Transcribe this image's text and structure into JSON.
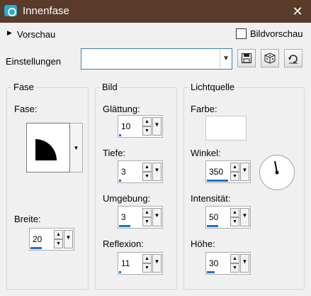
{
  "window": {
    "title": "Innenfase",
    "close_glyph": "✕",
    "icon": "camera-icon"
  },
  "preview": {
    "toggle_label": "Vorschau",
    "checkbox_label": "Bildvorschau",
    "checked": false
  },
  "settings": {
    "label": "Einstellungen",
    "combo_value": "",
    "buttons": [
      "save-icon",
      "dice-icon",
      "reset-icon"
    ]
  },
  "fase": {
    "group_title": "Fase",
    "fase_label": "Fase:",
    "breite_label": "Breite:",
    "breite_value": "20",
    "breite_level": 0.5
  },
  "bild": {
    "group_title": "Bild",
    "glaettung_label": "Glättung:",
    "glaettung_value": "10",
    "glaettung_level": 0.1,
    "tiefe_label": "Tiefe:",
    "tiefe_value": "3",
    "tiefe_level": 0.1,
    "umgebung_label": "Umgebung:",
    "umgebung_value": "3",
    "umgebung_level": 0.5,
    "reflexion_label": "Reflexion:",
    "reflexion_value": "11",
    "reflexion_level": 0.1
  },
  "licht": {
    "group_title": "Lichtquelle",
    "farbe_label": "Farbe:",
    "farbe_color": "#ffffff",
    "winkel_label": "Winkel:",
    "winkel_value": "350",
    "winkel_level": 0.95,
    "intensitaet_label": "Intensität:",
    "intensitaet_value": "50",
    "intensitaet_level": 0.5,
    "hoehe_label": "Höhe:",
    "hoehe_value": "30",
    "hoehe_level": 0.33
  },
  "colors": {
    "titlebar": "#5a3a28",
    "accent": "#1e72c9"
  }
}
